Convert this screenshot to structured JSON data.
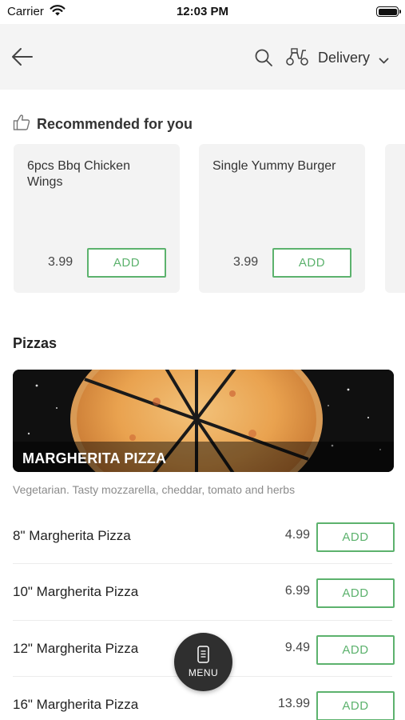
{
  "status_bar": {
    "carrier": "Carrier",
    "time": "12:03 PM"
  },
  "nav": {
    "delivery_label": "Delivery"
  },
  "recommended": {
    "title": "Recommended for you",
    "items": [
      {
        "name": "6pcs Bbq Chicken Wings",
        "price": "3.99",
        "add_label": "ADD"
      },
      {
        "name": "Single Yummy Burger",
        "price": "3.99",
        "add_label": "ADD"
      }
    ]
  },
  "pizzas": {
    "section_title": "Pizzas",
    "banner_title": "MARGHERITA PIZZA",
    "description": "Vegetarian. Tasty mozzarella, cheddar, tomato and herbs",
    "items": [
      {
        "name": "8\" Margherita Pizza",
        "price": "4.99",
        "add_label": "ADD"
      },
      {
        "name": "10\" Margherita Pizza",
        "price": "6.99",
        "add_label": "ADD"
      },
      {
        "name": "12\" Margherita Pizza",
        "price": "9.49",
        "add_label": "ADD"
      },
      {
        "name": "16\" Margherita Pizza",
        "price": "13.99",
        "add_label": "ADD"
      }
    ]
  },
  "menu_fab": {
    "label": "MENU"
  },
  "colors": {
    "accent": "#5cb26d",
    "nav_bg": "#f4f4f4",
    "card_bg": "#f3f3f3",
    "fab_bg": "#2f2f2f"
  },
  "icons": [
    "wifi-icon",
    "battery-icon",
    "back-arrow-icon",
    "search-icon",
    "scooter-icon",
    "chevron-down-icon",
    "thumbs-up-icon",
    "menu-phone-icon"
  ]
}
